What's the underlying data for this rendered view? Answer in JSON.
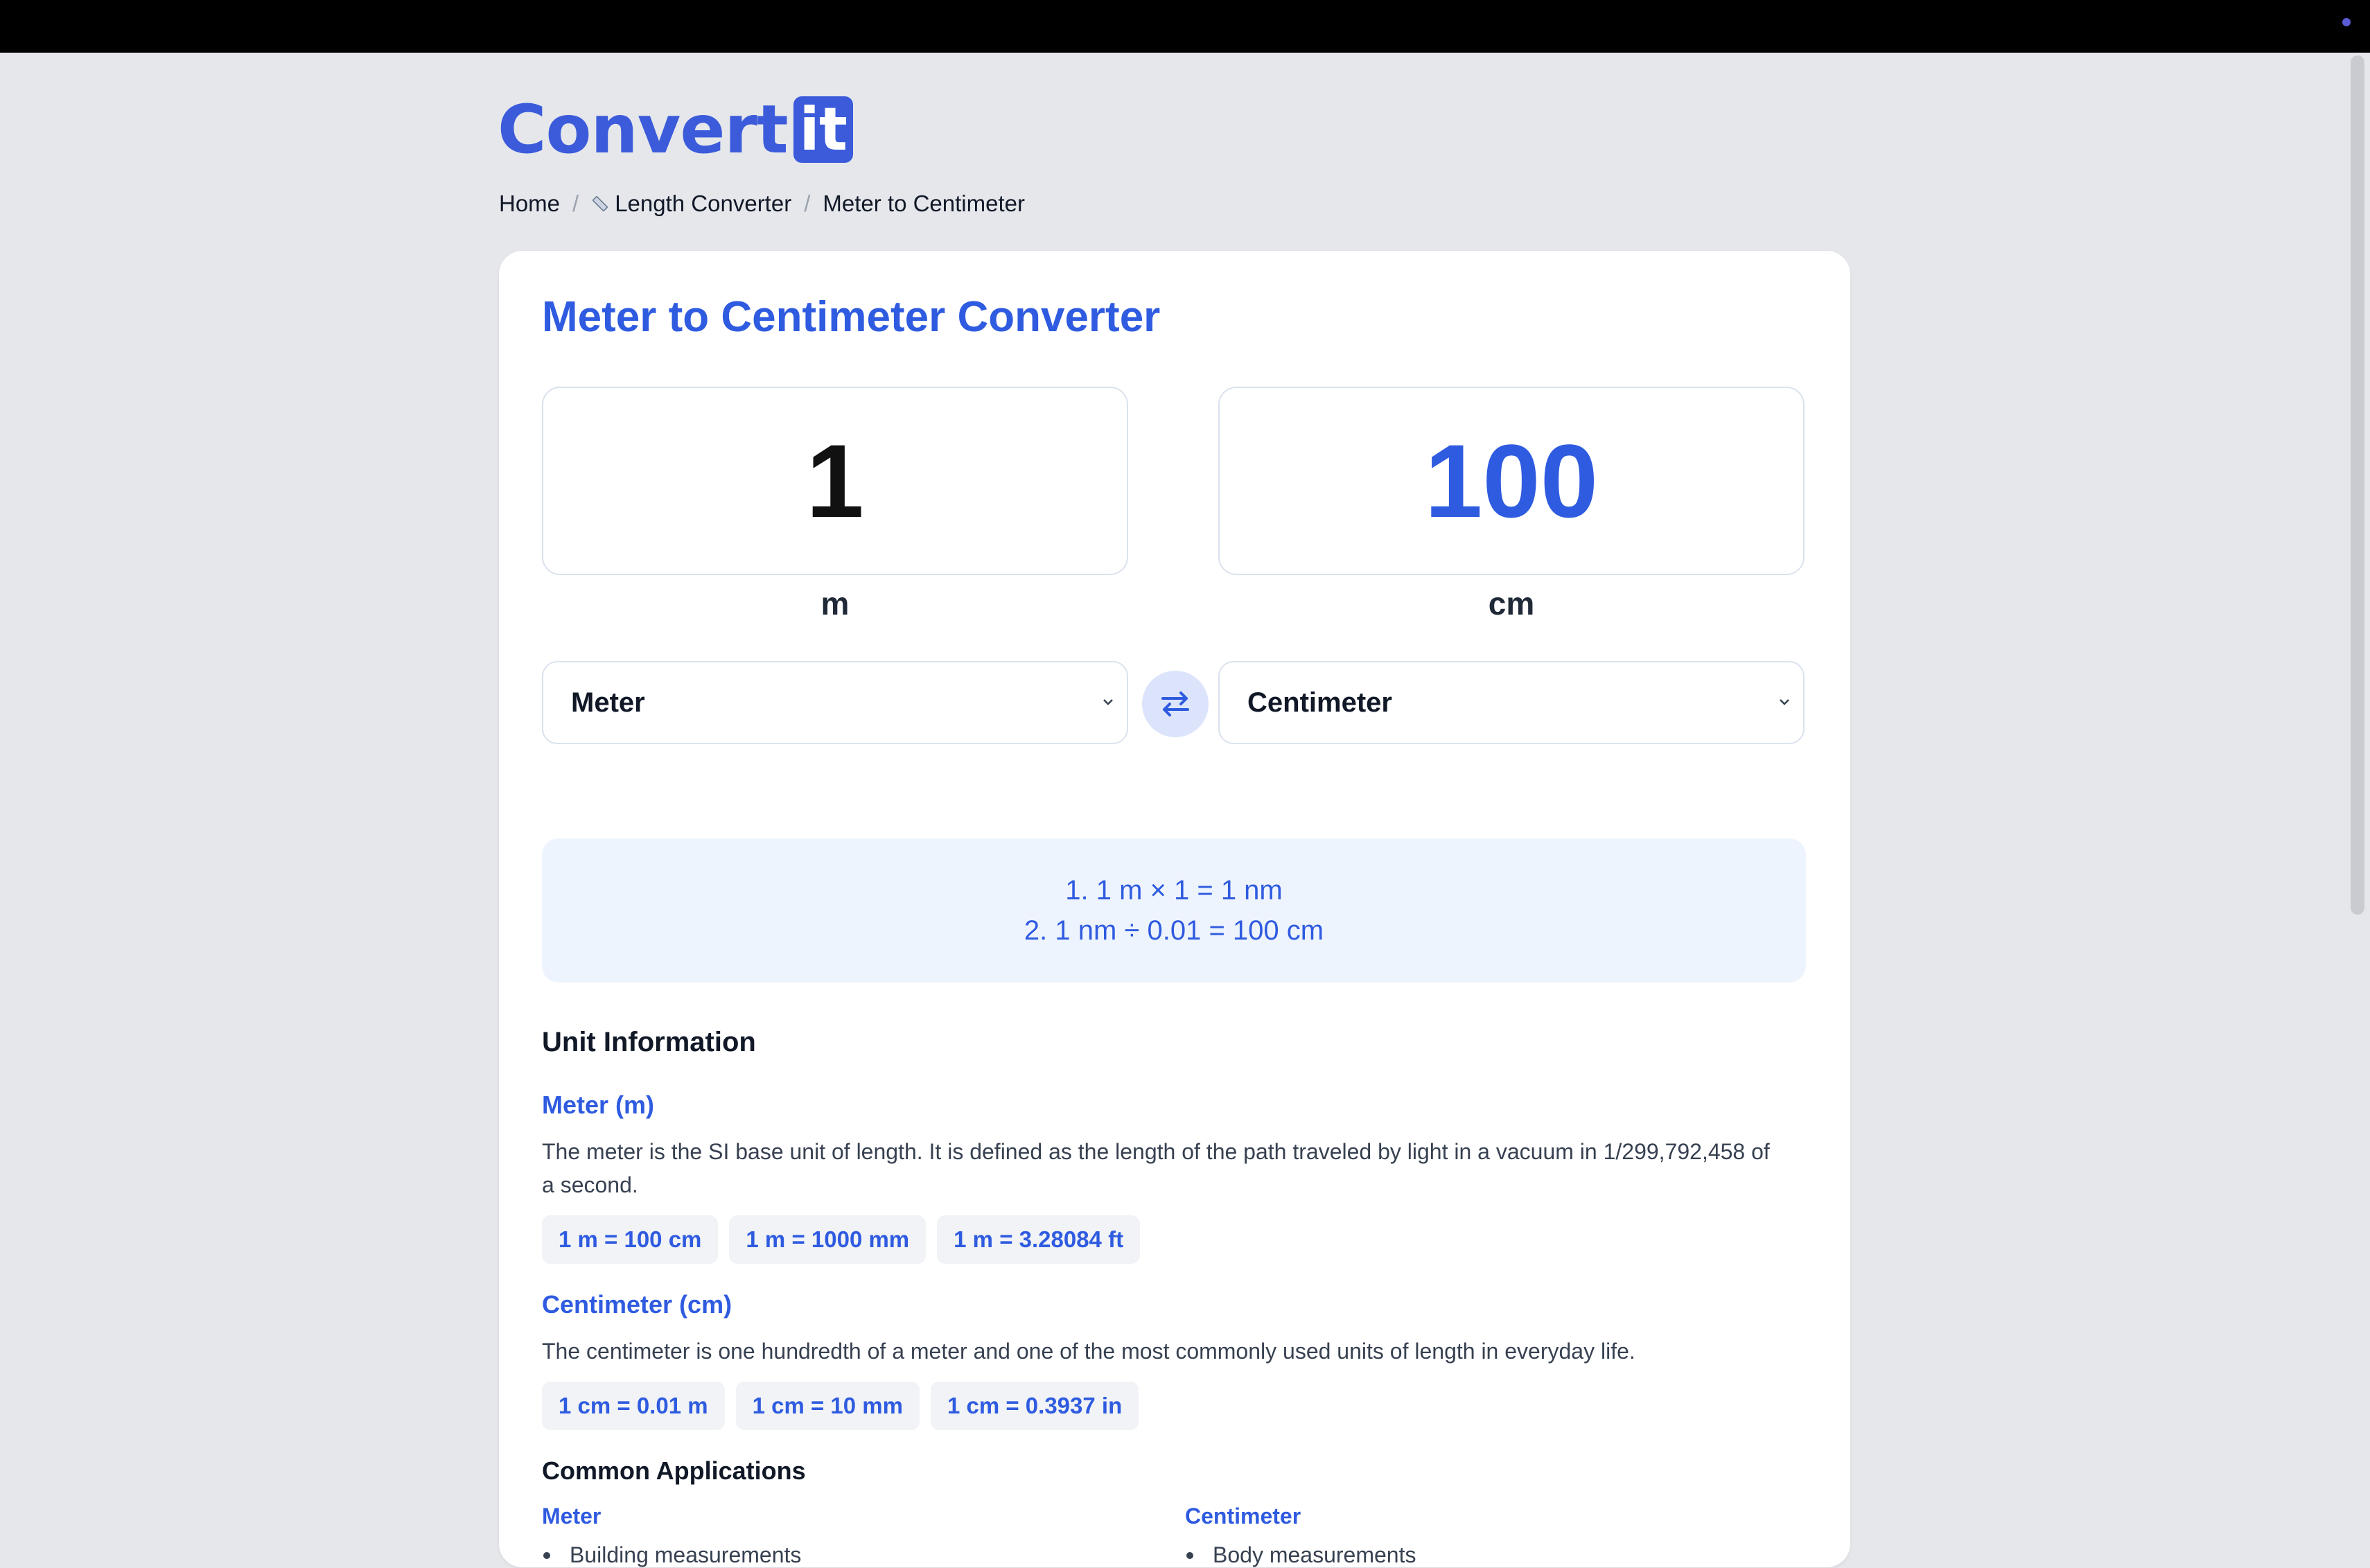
{
  "brand": {
    "name": "Convert",
    "badge": "it"
  },
  "breadcrumb": {
    "home": "Home",
    "category": "Length Converter",
    "current": "Meter to Centimeter",
    "separator": "/"
  },
  "converter": {
    "title": "Meter to Centimeter Converter",
    "from_value": "1",
    "to_value": "100",
    "from_unit_symbol": "m",
    "to_unit_symbol": "cm",
    "from_unit": "Meter",
    "to_unit": "Centimeter"
  },
  "formula": {
    "line1": "1. 1 m × 1 = 1 nm",
    "line2": "2. 1 nm ÷ 0.01 = 100 cm"
  },
  "unit_info": {
    "heading": "Unit Information",
    "meter": {
      "title": "Meter (m)",
      "description": "The meter is the SI base unit of length. It is defined as the length of the path traveled by light in a vacuum in 1/299,792,458 of a second.",
      "chips": [
        "1 m = 100 cm",
        "1 m = 1000 mm",
        "1 m = 3.28084 ft"
      ]
    },
    "centimeter": {
      "title": "Centimeter (cm)",
      "description": "The centimeter is one hundredth of a meter and one of the most commonly used units of length in everyday life.",
      "chips": [
        "1 cm = 0.01 m",
        "1 cm = 10 mm",
        "1 cm = 0.3937 in"
      ]
    }
  },
  "applications": {
    "heading": "Common Applications",
    "meter": {
      "title": "Meter",
      "items": [
        "Building measurements"
      ]
    },
    "centimeter": {
      "title": "Centimeter",
      "items": [
        "Body measurements"
      ]
    }
  },
  "colors": {
    "accent": "#2f5be0",
    "background": "#e5e7eb",
    "formula_bg": "#eef4fd"
  }
}
